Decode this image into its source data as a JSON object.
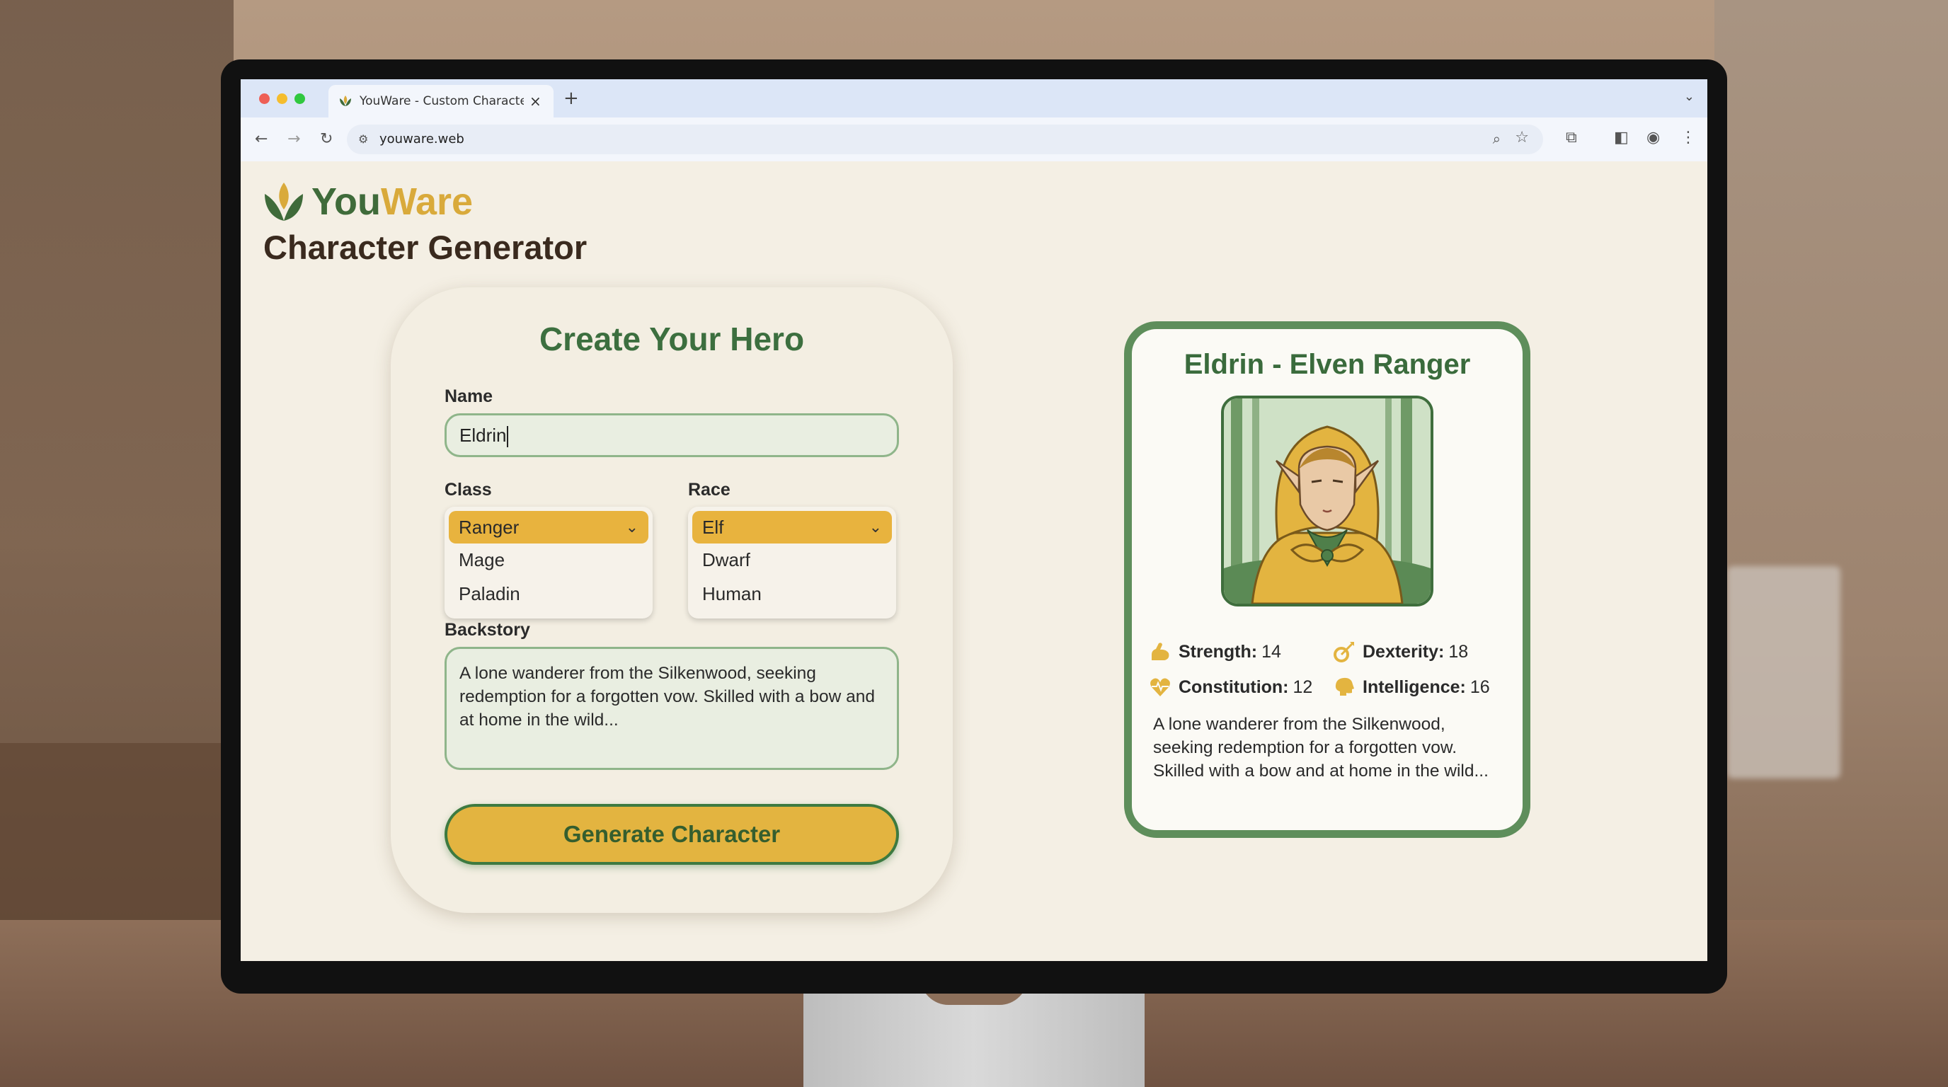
{
  "browser": {
    "tab_title": "YouWare - Custom Character",
    "url": "youware.web"
  },
  "brand": {
    "you": "You",
    "ware": "Ware"
  },
  "page_title": "Character Generator",
  "form": {
    "heading": "Create Your Hero",
    "name_label": "Name",
    "name_value": "Eldrin",
    "class_label": "Class",
    "class_selected": "Ranger",
    "class_options": [
      "Mage",
      "Paladin"
    ],
    "race_label": "Race",
    "race_selected": "Elf",
    "race_options": [
      "Dwarf",
      "Human"
    ],
    "backstory_label": "Backstory",
    "backstory_value": "A lone wanderer from the Silkenwood, seeking redemption for a forgotten vow. Skilled with a bow and at home in the wild...",
    "generate_label": "Generate Character"
  },
  "result": {
    "title": "Eldrin - Elven Ranger",
    "stats": [
      {
        "label": "Strength:",
        "value": "14",
        "icon": "flexed-arm-icon"
      },
      {
        "label": "Dexterity:",
        "value": "18",
        "icon": "arrow-target-icon"
      },
      {
        "label": "Constitution:",
        "value": "12",
        "icon": "heartbeat-icon"
      },
      {
        "label": "Intelligence:",
        "value": "16",
        "icon": "brain-icon"
      }
    ],
    "story": "A lone wanderer from the Silkenwood, seeking redemption for a forgotten vow. Skilled with a bow and at home in the wild..."
  },
  "colors": {
    "brand_green": "#3f6b3a",
    "brand_gold": "#d9aa3b",
    "accent_gold": "#e8b33e",
    "card_border_green": "#5e8e5b",
    "page_bg": "#f4efe4"
  }
}
